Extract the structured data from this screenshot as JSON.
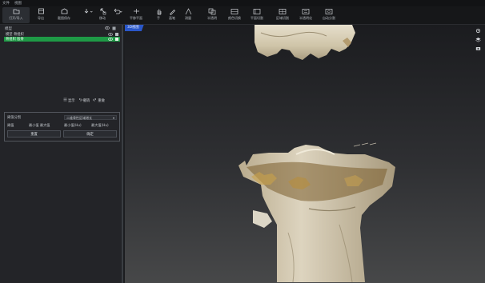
{
  "menu": [
    "文件",
    "视图"
  ],
  "toolbar": {
    "buttons": [
      {
        "label": "打开/导入",
        "icon": "folder-open-icon"
      },
      {
        "label": "导出",
        "icon": "export-icon"
      },
      {
        "label": "截图保存",
        "icon": "screenshot-icon"
      },
      {
        "label": "",
        "icon": "download-icon"
      },
      {
        "label": "移动",
        "icon": "move-icon"
      },
      {
        "label": "",
        "icon": "undo-icon"
      },
      {
        "label": "平移平面",
        "icon": "plane-icon"
      },
      {
        "label": "手",
        "icon": "hand-icon"
      },
      {
        "label": "画笔",
        "icon": "pen-icon"
      },
      {
        "label": "测量",
        "icon": "measure-icon"
      },
      {
        "label": "半透明",
        "icon": "transparent-icon"
      },
      {
        "label": "颜色切换",
        "icon": "color-icon"
      },
      {
        "label": "平面切割",
        "icon": "cut-icon"
      },
      {
        "label": "区域切割",
        "icon": "region-cut-icon"
      },
      {
        "label": "半透明化",
        "icon": "transparency-icon"
      },
      {
        "label": "自动分割",
        "icon": "auto-segment-icon"
      }
    ],
    "active_index": 0
  },
  "sidebar": {
    "panel_title": "模型",
    "rows": [
      {
        "label": "模型 骨组织",
        "selected": false
      },
      {
        "label": "骨组织 股骨",
        "selected": true
      }
    ],
    "actions": [
      {
        "label": "显示",
        "icon": "list-icon"
      },
      {
        "label": "撤销",
        "icon": "undo-icon"
      },
      {
        "label": "重做",
        "icon": "redo-icon"
      }
    ],
    "form": {
      "title": "阈值分割",
      "select_value": "二维骨性区域增长",
      "cells": [
        "阈值",
        "最小值 最大值",
        "最小值(Hu)",
        "最大值(Hu)"
      ],
      "buttons": [
        "重置",
        "确定"
      ]
    }
  },
  "viewport": {
    "tag": "3D视图"
  },
  "colors": {
    "accent_green": "#1e9a46",
    "accent_blue": "#2a57c9",
    "bone": "#d8cfb8"
  }
}
